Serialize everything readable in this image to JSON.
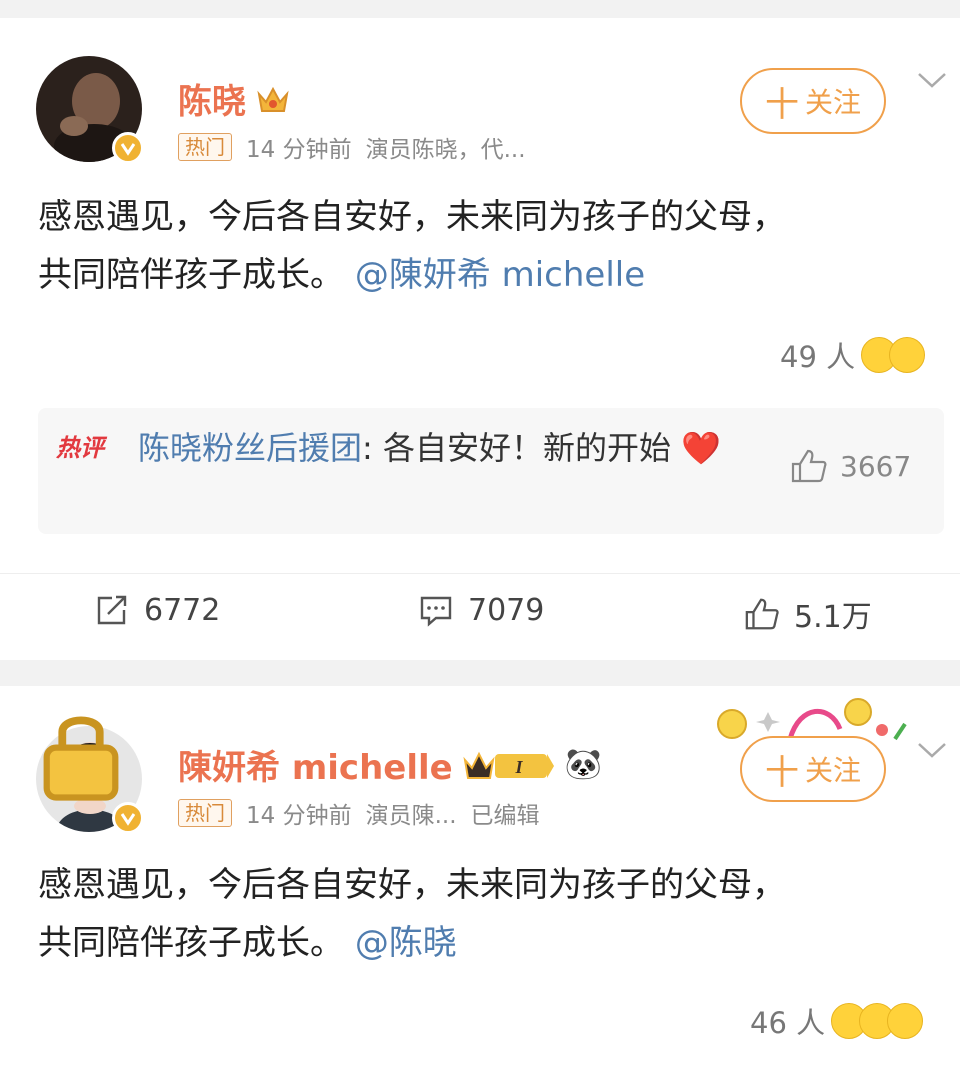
{
  "posts": [
    {
      "username": "陈晓",
      "hot_tag": "热门",
      "time": "14 分钟前",
      "source": "演员陈晓，代...",
      "follow_label": "关注",
      "follow_plus": "十",
      "text_line1": "感恩遇见，今后各自安好，未来同为孩子的父母，",
      "text_line2_prefix": "共同陪伴孩子成长。",
      "mention": "@陳妍希 michelle",
      "reaction_count": "49 人",
      "hot_comment": {
        "label": "热评",
        "author": "陈晓粉丝后援团",
        "text": ": 各自安好！新的开始",
        "heart": "❤️",
        "likes": "3667"
      },
      "reposts": "6772",
      "comments": "7079",
      "likes": "5.1万"
    },
    {
      "username": "陳妍希 michelle",
      "hot_tag": "热门",
      "time": "14 分钟前",
      "source": "演员陳...",
      "edited": "已编辑",
      "follow_label": "关注",
      "follow_plus": "十",
      "text_line1": "感恩遇见，今后各自安好，未来同为孩子的父母，",
      "text_line2_prefix": "共同陪伴孩子成长。",
      "mention": "@陈晓",
      "reaction_count": "46 人",
      "member_badge": "I",
      "panda": "🐼"
    }
  ],
  "colors": {
    "username": "#eb7350",
    "mention": "#507daf",
    "follow": "#f0a04b",
    "hot_comment_label": "#e2393f",
    "vip_badge": "#f0b232"
  },
  "icons": [
    "crown-icon",
    "verified-icon",
    "chevron-down-icon",
    "repost-icon",
    "comment-icon",
    "like-icon",
    "emoji-reaction-icon",
    "heart-icon",
    "panda-icon"
  ]
}
